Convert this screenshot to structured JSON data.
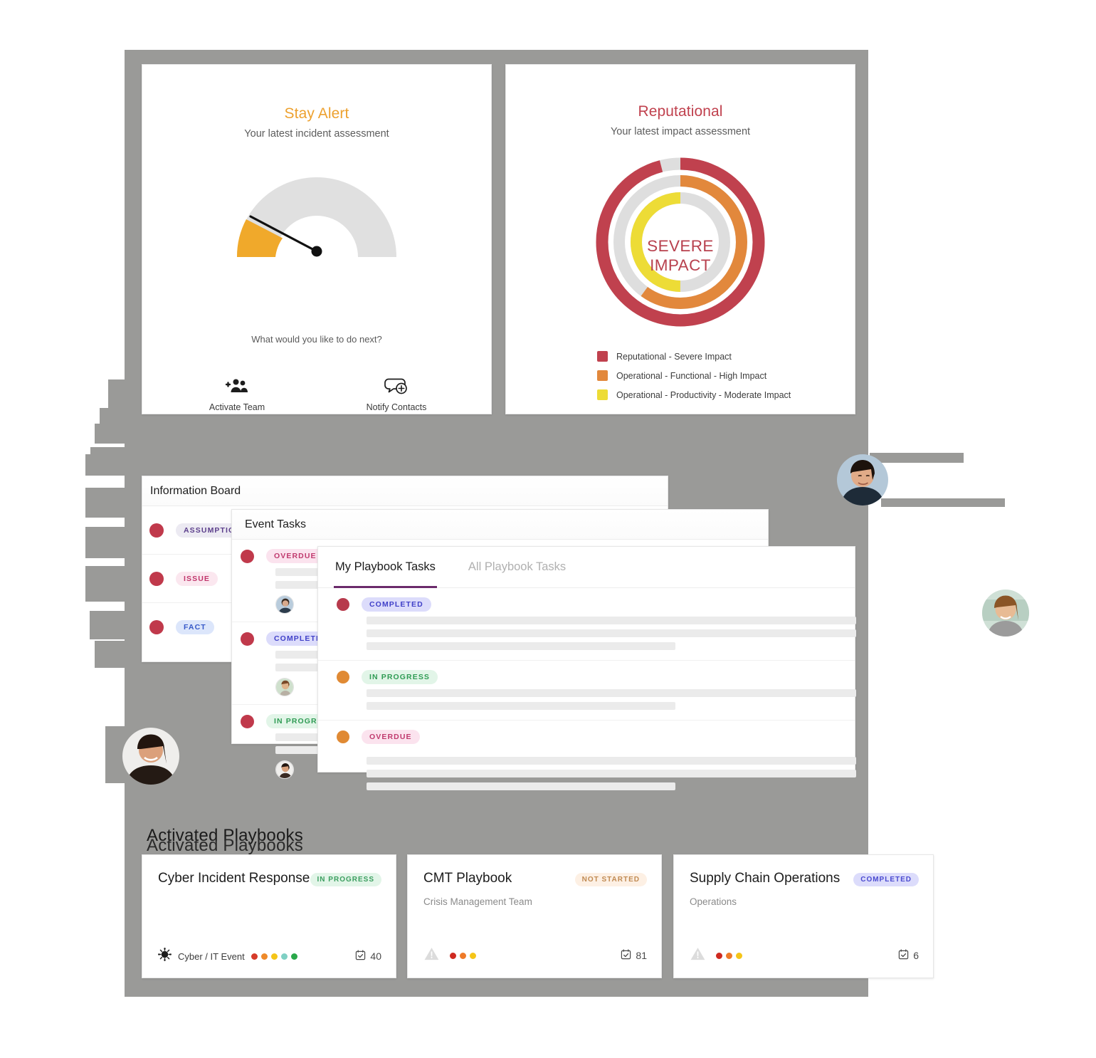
{
  "stay_alert": {
    "title": "Stay Alert",
    "subtitle": "Your latest incident assessment",
    "prompt": "What would you like to do next?",
    "title_color": "#eda12f",
    "gauge": {
      "value_pct": 22,
      "fill_color": "#f0a92b",
      "track_color": "#e0e0e0",
      "needle_color": "#000000"
    },
    "actions": [
      {
        "label": "Activate Team",
        "icon": "add-people-icon"
      },
      {
        "label": "Notify Contacts",
        "icon": "notify-chat-icon"
      }
    ]
  },
  "reputational": {
    "title": "Reputational",
    "subtitle": "Your latest impact assessment",
    "center_label": "SEVERE\nIMPACT",
    "title_color": "#c0414e",
    "legend": [
      {
        "label": "Reputational - Severe Impact",
        "color": "#c0414e"
      },
      {
        "label": "Operational - Functional - High Impact",
        "color": "#e2883c"
      },
      {
        "label": "Operational - Productivity - Moderate Impact",
        "color": "#eddc36"
      }
    ],
    "chart_data": {
      "type": "pie",
      "title": "Reputational",
      "subtitle": "Your latest impact assessment",
      "center_text": "SEVERE IMPACT",
      "legend_position": "bottom-left",
      "rings": [
        {
          "name": "Reputational - Severe Impact",
          "color": "#c0414e",
          "value": 96,
          "max": 100,
          "track_color": "#dedede",
          "ring": "outer"
        },
        {
          "name": "Operational - Functional - High Impact",
          "color": "#e2883c",
          "value": 60,
          "max": 100,
          "track_color": "#dedede",
          "ring": "middle"
        },
        {
          "name": "Operational - Productivity - Moderate Impact",
          "color": "#eddc36",
          "value": 50,
          "max": 100,
          "track_color": "#dedede",
          "ring": "inner"
        }
      ]
    }
  },
  "information_board": {
    "title": "Information Board",
    "rows": [
      {
        "label": "ASSUMPTION",
        "chip_class": "chip-assumption"
      },
      {
        "label": "ISSUE",
        "chip_class": "chip-issue"
      },
      {
        "label": "FACT",
        "chip_class": "chip-fact"
      }
    ]
  },
  "event_tasks": {
    "title": "Event Tasks",
    "rows": [
      {
        "label": "OVERDUE",
        "chip_class": "chip-overdue",
        "dot_color": "#c0394b"
      },
      {
        "label": "COMPLETED",
        "chip_class": "chip-completed",
        "dot_color": "#c0394b"
      },
      {
        "label": "IN PROGRESS",
        "chip_class": "chip-inprogress",
        "dot_color": "#c0394b"
      }
    ]
  },
  "playbook_tasks": {
    "tabs": [
      {
        "label": "My Playbook Tasks",
        "active": true
      },
      {
        "label": "All Playbook Tasks",
        "active": false
      }
    ],
    "rows": [
      {
        "label": "COMPLETED",
        "chip_class": "chip-completed",
        "dot_color": "#b73a4c"
      },
      {
        "label": "IN PROGRESS",
        "chip_class": "chip-inprogress",
        "dot_color": "#e08a34"
      },
      {
        "label": "OVERDUE",
        "chip_class": "chip-overdue",
        "dot_color": "#e08a34"
      }
    ]
  },
  "activated_playbooks": {
    "title": "Activated Playbooks",
    "cards": [
      {
        "name": "Cyber Incident Response",
        "subtitle": "",
        "badge": "IN PROGRESS",
        "badge_class": "badge-inprogress",
        "icon": "virus-icon",
        "category": "Cyber / IT Event",
        "dots": [
          "#d63b2a",
          "#ee8a2a",
          "#f5c518",
          "#7fd0c4",
          "#2aa84a"
        ],
        "count": "40"
      },
      {
        "name": "CMT Playbook",
        "subtitle": "Crisis Management Team",
        "badge": "NOT STARTED",
        "badge_class": "badge-notstarted",
        "icon": "warning-triangle-icon",
        "category": "",
        "dots": [
          "#cf2a20",
          "#ee7a28",
          "#f5c518"
        ],
        "count": "81"
      },
      {
        "name": "Supply Chain Operations",
        "subtitle": "Operations",
        "badge": "COMPLETED",
        "badge_class": "badge-completed",
        "icon": "warning-triangle-icon",
        "category": "",
        "dots": [
          "#cf2a20",
          "#ee7a28",
          "#f5c518"
        ],
        "count": "6"
      }
    ]
  }
}
